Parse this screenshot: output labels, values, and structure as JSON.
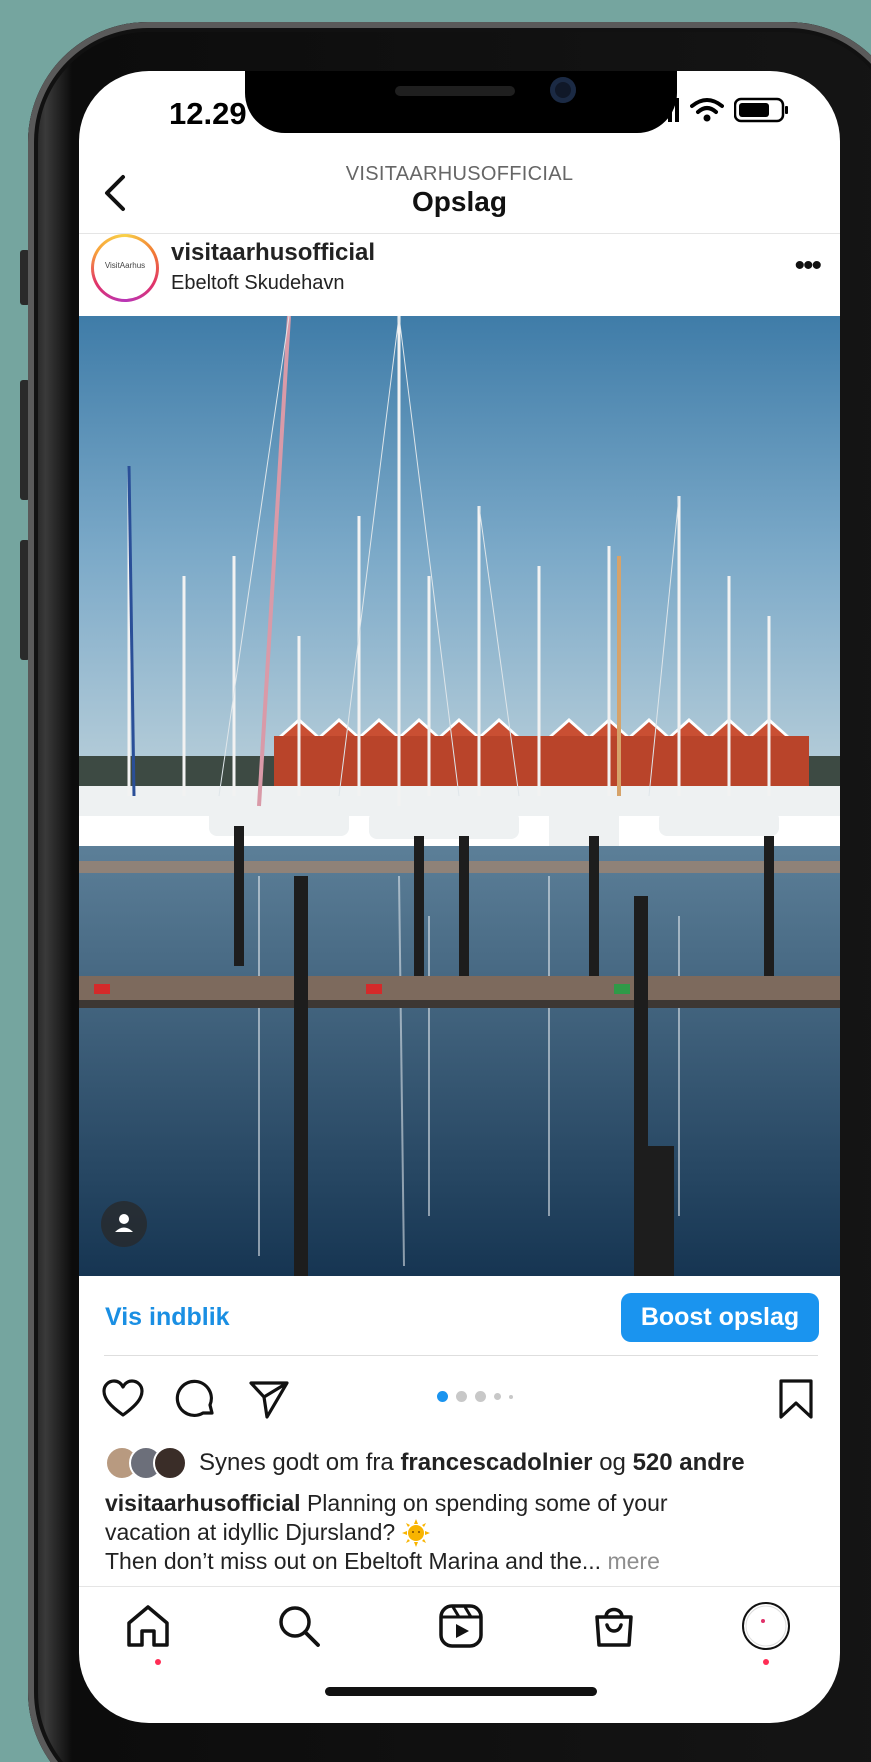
{
  "status": {
    "time": "12.29"
  },
  "header": {
    "account_upper": "VISITAARHUSOFFICIAL",
    "title": "Opslag"
  },
  "post": {
    "avatar_text": "VisitAarhus",
    "account": "visitaarhusofficial",
    "location": "Ebeltoft Skudehavn"
  },
  "insights": {
    "view_label": "Vis indblik",
    "boost_label": "Boost opslag"
  },
  "carousel": {
    "count": 5,
    "active": 0
  },
  "likes": {
    "prefix": "Synes godt om fra",
    "user": "francescadolnier",
    "joiner": "og",
    "others": "520 andre"
  },
  "caption": {
    "account": "visitaarhusofficial",
    "line1": "Planning on spending some of your",
    "line2": "vacation at idyllic Djursland?",
    "line3": "Then don’t miss out on Ebeltoft Marina and the...",
    "more": "mere"
  },
  "colors": {
    "accent": "#1a94ef",
    "notification": "#ff2d55",
    "background": "#75a59f"
  },
  "icons": [
    "back-icon",
    "more-icon",
    "user-tag-icon",
    "heart-icon",
    "comment-icon",
    "share-icon",
    "bookmark-icon",
    "home-icon",
    "search-icon",
    "reels-icon",
    "shop-icon",
    "profile-icon"
  ]
}
